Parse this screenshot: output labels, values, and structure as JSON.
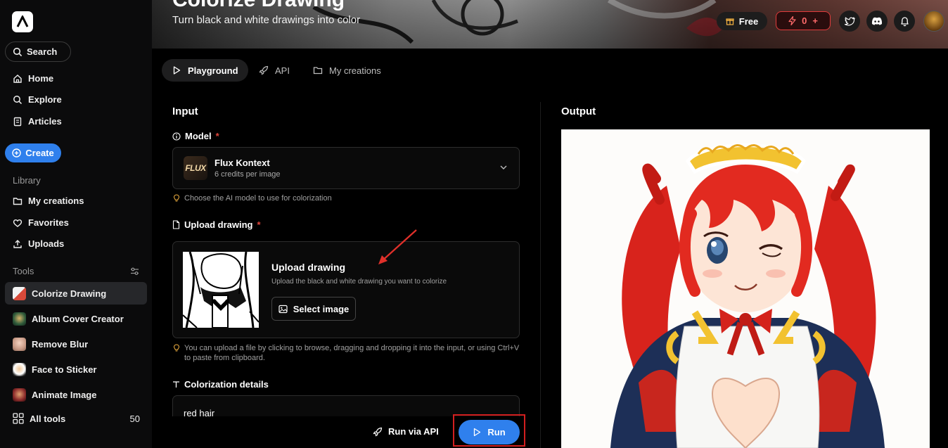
{
  "sidebar": {
    "search_label": "Search",
    "nav": [
      {
        "label": "Home",
        "icon": "home-icon"
      },
      {
        "label": "Explore",
        "icon": "explore-search-icon"
      },
      {
        "label": "Articles",
        "icon": "articles-icon"
      }
    ],
    "create_label": "Create",
    "library_title": "Library",
    "library": [
      {
        "label": "My creations",
        "icon": "folder-icon"
      },
      {
        "label": "Favorites",
        "icon": "heart-icon"
      },
      {
        "label": "Uploads",
        "icon": "upload-icon"
      }
    ],
    "tools_title": "Tools",
    "tools": [
      {
        "label": "Colorize Drawing",
        "active": true
      },
      {
        "label": "Album Cover Creator",
        "active": false
      },
      {
        "label": "Remove Blur",
        "active": false
      },
      {
        "label": "Face to Sticker",
        "active": false
      },
      {
        "label": "Animate Image",
        "active": false
      }
    ],
    "all_tools_label": "All tools",
    "all_tools_count": "50"
  },
  "header": {
    "title": "Colorize Drawing",
    "subtitle": "Turn black and white drawings into color",
    "plan_label": "Free",
    "credits_value": "0",
    "credits_plus": "+"
  },
  "tabs": [
    {
      "label": "Playground",
      "icon": "play-icon",
      "active": true
    },
    {
      "label": "API",
      "icon": "rocket-icon",
      "active": false
    },
    {
      "label": "My creations",
      "icon": "folder-icon",
      "active": false
    }
  ],
  "input": {
    "heading": "Input",
    "model_label": "Model",
    "required_mark": "*",
    "model_name": "Flux Kontext",
    "model_credits": "6 credits per image",
    "model_logo_text": "FLUX",
    "model_hint": "Choose the AI model to use for colorization",
    "upload_label": "Upload drawing",
    "upload_title": "Upload drawing",
    "upload_desc": "Upload the black and white drawing you want to colorize",
    "select_image_label": "Select image",
    "upload_hint_line1": "You can upload a file by clicking to browse, dragging and dropping it into the input, or using Ctrl+V",
    "upload_hint_line2": "to paste from clipboard.",
    "details_label": "Colorization details",
    "details_value": "red hair"
  },
  "actions": {
    "run_api_label": "Run via API",
    "run_label": "Run"
  },
  "output": {
    "heading": "Output"
  },
  "colors": {
    "accent": "#2f80ed",
    "danger": "#e03b3b",
    "highlight_frame": "#d21f1f",
    "annotation_arrow": "#e0302a"
  }
}
